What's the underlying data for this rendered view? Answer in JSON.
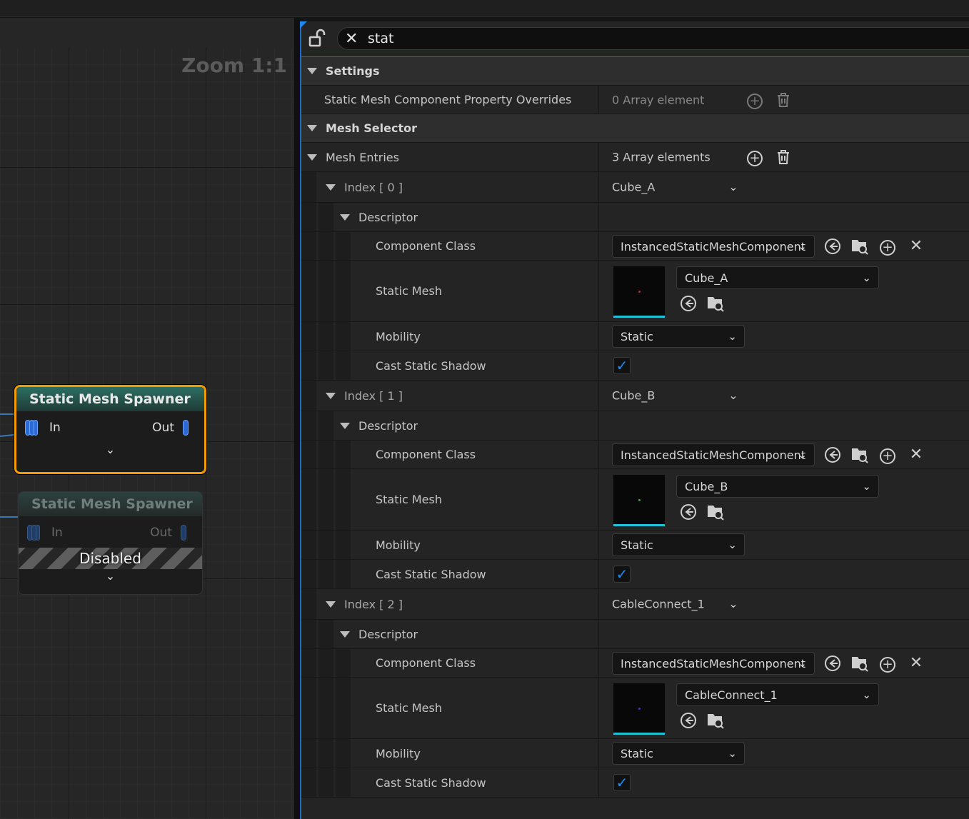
{
  "graph": {
    "zoom": "Zoom 1:1",
    "nodes": [
      {
        "title": "Static Mesh Spawner",
        "in": "In",
        "out": "Out",
        "selected": true,
        "disabled": false
      },
      {
        "title": "Static Mesh Spawner",
        "in": "In",
        "out": "Out",
        "selected": false,
        "disabled": true,
        "disabled_label": "Disabled"
      }
    ]
  },
  "details": {
    "search": {
      "value": "stat"
    },
    "categories": {
      "settings": "Settings",
      "mesh_selector": "Mesh Selector"
    },
    "overrides": {
      "label": "Static Mesh Component Property Overrides",
      "value": "0 Array element"
    },
    "mesh_entries": {
      "label": "Mesh Entries",
      "value": "3 Array elements"
    },
    "labels": {
      "descriptor": "Descriptor",
      "component_class": "Component Class",
      "static_mesh": "Static Mesh",
      "mobility": "Mobility",
      "cast_static_shadow": "Cast Static Shadow"
    },
    "entries": [
      {
        "index": "Index [ 0 ]",
        "name": "Cube_A",
        "component_class": "InstancedStaticMeshComponent",
        "static_mesh": "Cube_A",
        "mobility": "Static",
        "cast_static_shadow": true,
        "thumb_dot_color": "#c0282a"
      },
      {
        "index": "Index [ 1 ]",
        "name": "Cube_B",
        "component_class": "InstancedStaticMeshComponent",
        "static_mesh": "Cube_B",
        "mobility": "Static",
        "cast_static_shadow": true,
        "thumb_dot_color": "#2fa84a"
      },
      {
        "index": "Index [ 2 ]",
        "name": "CableConnect_1",
        "component_class": "InstancedStaticMeshComponent",
        "static_mesh": "CableConnect_1",
        "mobility": "Static",
        "cast_static_shadow": true,
        "thumb_dot_color": "#3a3ad8"
      }
    ],
    "colors": {
      "accent": "#1c6bd0",
      "selected_node_border": "#f39b00",
      "check": "#1e8ef0"
    }
  }
}
